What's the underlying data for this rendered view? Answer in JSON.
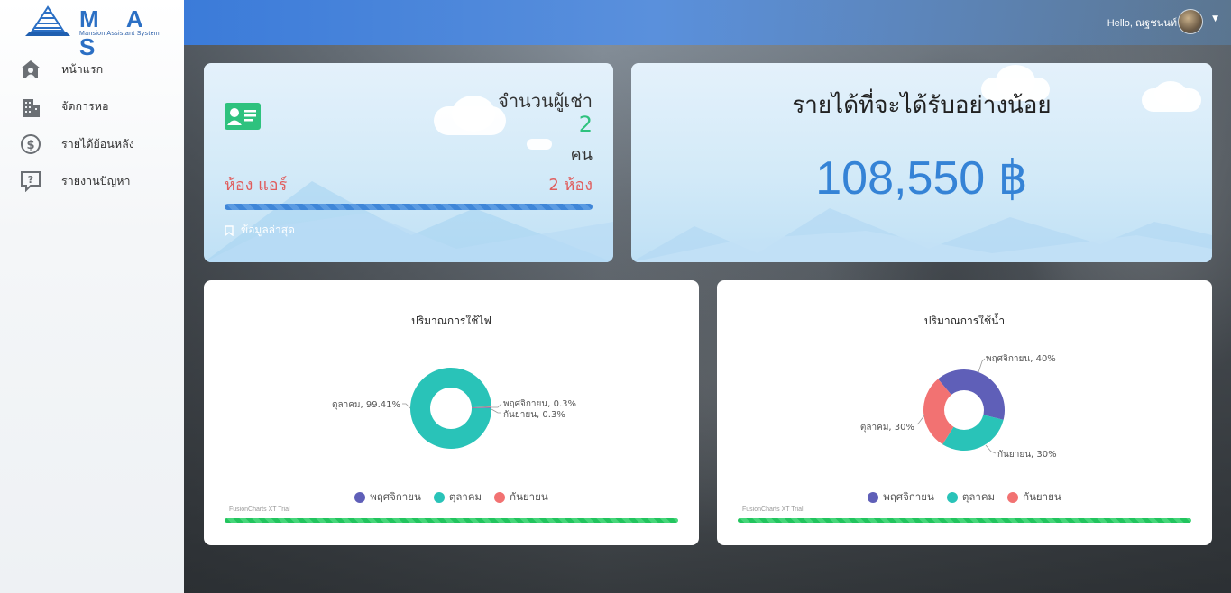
{
  "app": {
    "logo_letters": "M A S",
    "logo_subtitle": "Mansion Assistant System"
  },
  "header": {
    "greeting": "Hello, ณฐชนนท์"
  },
  "sidebar": {
    "items": [
      {
        "label": "หน้าแรก",
        "icon": "home-icon"
      },
      {
        "label": "จัดการหอ",
        "icon": "building-icon"
      },
      {
        "label": "รายได้ย้อนหลัง",
        "icon": "dollar-icon"
      },
      {
        "label": "รายงานปัญหา",
        "icon": "question-bubble-icon"
      }
    ]
  },
  "tenants_card": {
    "title": "จำนวนผู้เช่า",
    "count": "2",
    "unit": "คน",
    "room_label": "ห้อง แอร์",
    "room_value": "2 ห้อง",
    "latest_label": "ข้อมูลล่าสุด"
  },
  "income_card": {
    "title": "รายได้ที่จะได้รับอย่างน้อย",
    "value": "108,550 ฿"
  },
  "colors": {
    "series_purple": "#5f5fb8",
    "series_teal": "#29c3b8",
    "series_red": "#f27272",
    "accent_blue": "#3583d6",
    "accent_green": "#2ec27e"
  },
  "charts": {
    "trial_text": "FusionCharts XT Trial",
    "electricity": {
      "title": "ปริมาณการใช้ไฟ",
      "legend": [
        "พฤศจิกายน",
        "ตุลาคม",
        "กันยายน"
      ],
      "labels": {
        "left": "ตุลาคม, 99.41%",
        "right1": "พฤศจิกายน, 0.3%",
        "right2": "กันยายน, 0.3%"
      }
    },
    "water": {
      "title": "ปริมาณการใช้น้ำ",
      "legend": [
        "พฤศจิกายน",
        "ตุลาคม",
        "กันยายน"
      ],
      "labels": {
        "top": "พฤศจิกายน, 40%",
        "left": "ตุลาคม, 30%",
        "bottom": "กันยายน, 30%"
      }
    }
  },
  "chart_data": [
    {
      "type": "pie",
      "title": "ปริมาณการใช้ไฟ",
      "categories": [
        "พฤศจิกายน",
        "ตุลาคม",
        "กันยายน"
      ],
      "values": [
        0.3,
        99.41,
        0.3
      ],
      "colors": [
        "#5f5fb8",
        "#29c3b8",
        "#f27272"
      ],
      "legend": "bottom"
    },
    {
      "type": "pie",
      "title": "ปริมาณการใช้น้ำ",
      "categories": [
        "พฤศจิกายน",
        "ตุลาคม",
        "กันยายน"
      ],
      "values": [
        40,
        30,
        30
      ],
      "colors": [
        "#5f5fb8",
        "#29c3b8",
        "#f27272"
      ],
      "legend": "bottom"
    }
  ]
}
